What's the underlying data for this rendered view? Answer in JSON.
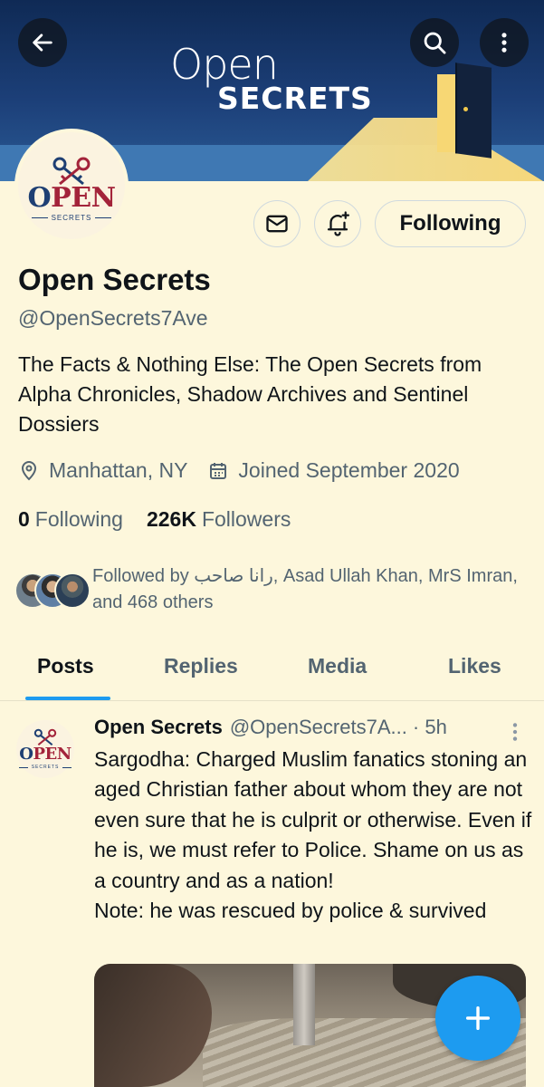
{
  "banner": {
    "logo_top": "Open",
    "logo_bottom": "SECRETS"
  },
  "avatar": {
    "word": "OPEN",
    "sub": "SECRETS"
  },
  "profile": {
    "name": "Open Secrets",
    "handle": "@OpenSecrets7Ave",
    "bio": "The Facts & Nothing Else: The Open Secrets from Alpha Chronicles, Shadow Archives and Sentinel Dossiers",
    "location": "Manhattan, NY",
    "joined": "Joined September 2020",
    "following_count": "0",
    "following_label": "Following",
    "followers_count": "226K",
    "followers_label": "Followers",
    "followed_by": "Followed by رانا صاحب, Asad Ullah Khan, MrS Imran, and 468 others"
  },
  "actions": {
    "follow_label": "Following"
  },
  "tabs": [
    {
      "label": "Posts"
    },
    {
      "label": "Replies"
    },
    {
      "label": "Media"
    },
    {
      "label": "Likes"
    }
  ],
  "post": {
    "author": "Open Secrets",
    "handle_time": "@OpenSecrets7A... · 5h",
    "text": "Sargodha: Charged Muslim fanatics stoning an aged Christian father about whom they are not even sure that he is culprit or otherwise. Even if he is, we must refer to Police. Shame on us as a country and as a nation!\nNote: he was rescued by police & survived"
  },
  "colors": {
    "background": "#fdf7dc",
    "accent": "#1d9bf0",
    "secondary_text": "#536471",
    "brand_red": "#a3233a",
    "brand_navy": "#1e3f73"
  },
  "icons": [
    "back-arrow-icon",
    "search-icon",
    "more-vertical-icon",
    "mail-icon",
    "bell-plus-icon",
    "location-pin-icon",
    "calendar-icon",
    "plus-icon"
  ]
}
